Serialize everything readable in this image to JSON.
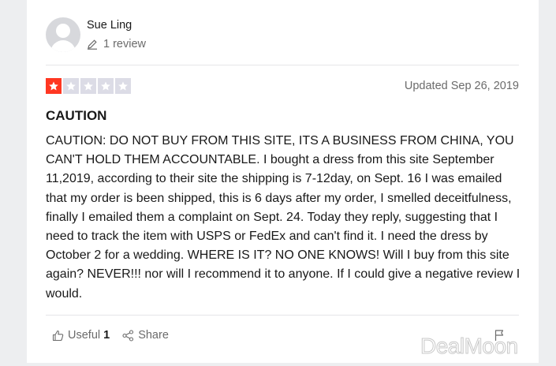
{
  "reviewer": {
    "name": "Sue Ling",
    "review_count": "1 review"
  },
  "review": {
    "rating": 1,
    "max_rating": 5,
    "date": "Updated Sep 26, 2019",
    "title": "CAUTION",
    "body": "CAUTION: DO NOT BUY FROM THIS SITE, ITS A BUSINESS FROM CHINA, YOU CAN'T HOLD THEM ACCOUNTABLE. I bought a dress from this site September 11,2019, according to their site the shipping is 7-12day, on Sept. 16 I was emailed that my order is been shipped, this is 6 days after my order, I smelled deceitfulness, finally I emailed them a complaint on Sept. 24. Today they reply, suggesting that I need to track the item with USPS or FedEx and can't find it. I need the dress by October 2 for a wedding. WHERE IS IT? NO ONE KNOWS! Will I buy from this site again? NEVER!!! nor will I recommend it to anyone. If I could give a negative review I would."
  },
  "actions": {
    "useful_label": "Useful",
    "useful_count": "1",
    "share_label": "Share"
  },
  "watermark": "DealMoon",
  "colors": {
    "star_filled": "#ff3722",
    "star_empty": "#dcdce6",
    "text_primary": "#191919",
    "text_secondary": "#6b6b6b"
  },
  "icons": [
    "avatar-icon",
    "pencil-icon",
    "star-icon",
    "thumbs-up-icon",
    "share-icon",
    "flag-icon"
  ]
}
